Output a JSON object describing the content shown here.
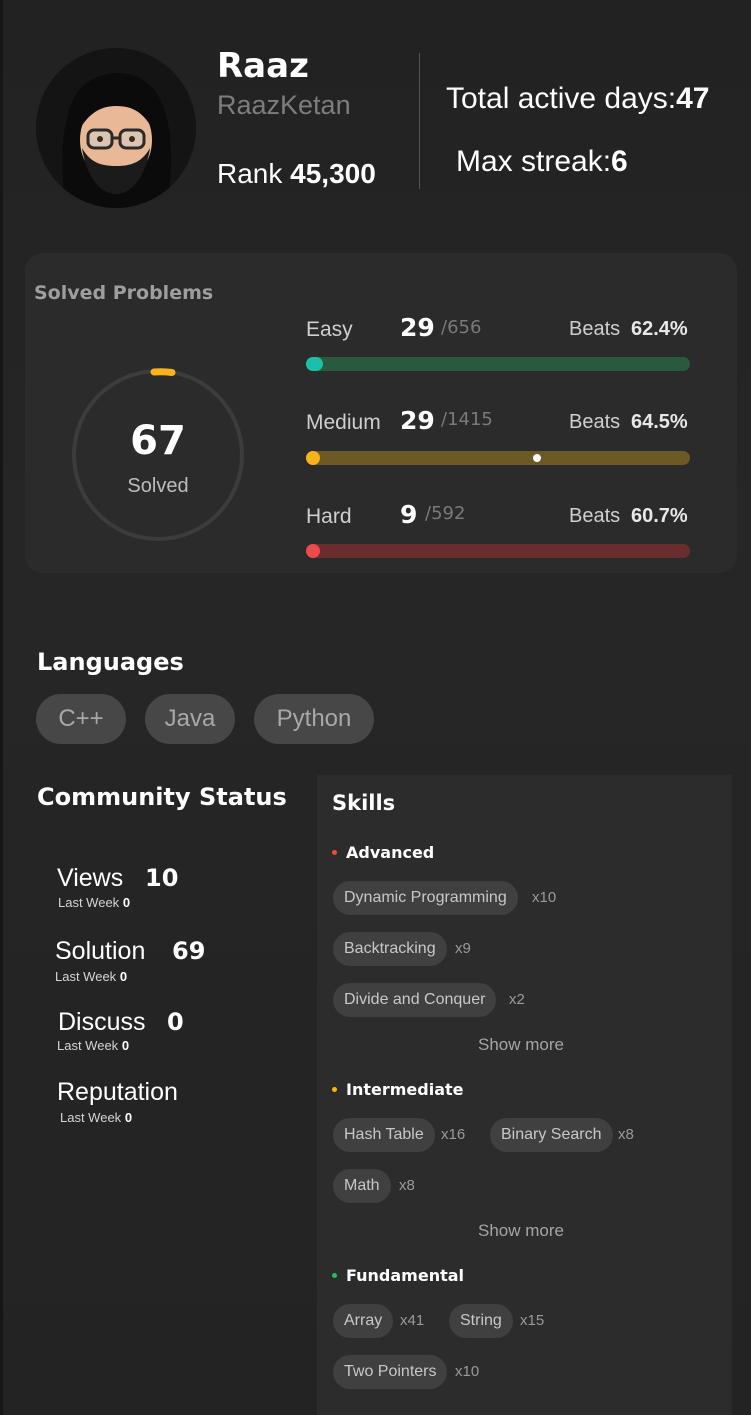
{
  "profile": {
    "name": "Raaz",
    "username": "RaazKetan",
    "rank_label": "Rank",
    "rank_value": "45,300",
    "active_days_label": "Total active days:",
    "active_days_value": "47",
    "max_streak_label": "Max streak:",
    "max_streak_value": "6"
  },
  "solved": {
    "title": "Solved Problems",
    "total": "67",
    "total_label": "Solved",
    "beats_label": "Beats",
    "difficulties": [
      {
        "label": "Easy",
        "solved": "29",
        "total": "/656",
        "beats": "62.4%",
        "color": "#1ebfa8",
        "progress": 0.044
      },
      {
        "label": "Medium",
        "solved": "29",
        "total": "/1415",
        "beats": "64.5%",
        "color": "#f8b21b",
        "progress": 0.02
      },
      {
        "label": "Hard",
        "solved": "9",
        "total": "/592",
        "beats": "60.7%",
        "color": "#ee4a4a",
        "progress": 0.015
      }
    ]
  },
  "languages": {
    "title": "Languages",
    "items": [
      "C++",
      "Java",
      "Python"
    ]
  },
  "community": {
    "title": "Community Status",
    "last_week_label": "Last Week",
    "stats": [
      {
        "label": "Views",
        "value": "10",
        "last_week": "0"
      },
      {
        "label": "Solution",
        "value": "69",
        "last_week": "0"
      },
      {
        "label": "Discuss",
        "value": "0",
        "last_week": "0"
      },
      {
        "label": "Reputation",
        "value": "",
        "last_week": "0"
      }
    ]
  },
  "skills": {
    "title": "Skills",
    "show_more_label": "Show more",
    "groups": [
      {
        "level": "Advanced",
        "color": "#ef4743",
        "items": [
          {
            "name": "Dynamic Programming",
            "count": "x10"
          },
          {
            "name": "Backtracking",
            "count": "x9"
          },
          {
            "name": "Divide and Conquer",
            "count": "x2"
          }
        ]
      },
      {
        "level": "Intermediate",
        "color": "#ffb800",
        "items": [
          {
            "name": "Hash Table",
            "count": "x16"
          },
          {
            "name": "Binary Search",
            "count": "x8"
          },
          {
            "name": "Math",
            "count": "x8"
          }
        ]
      },
      {
        "level": "Fundamental",
        "color": "#2cbb5d",
        "items": [
          {
            "name": "Array",
            "count": "x41"
          },
          {
            "name": "String",
            "count": "x15"
          },
          {
            "name": "Two Pointers",
            "count": "x10"
          }
        ]
      }
    ]
  }
}
